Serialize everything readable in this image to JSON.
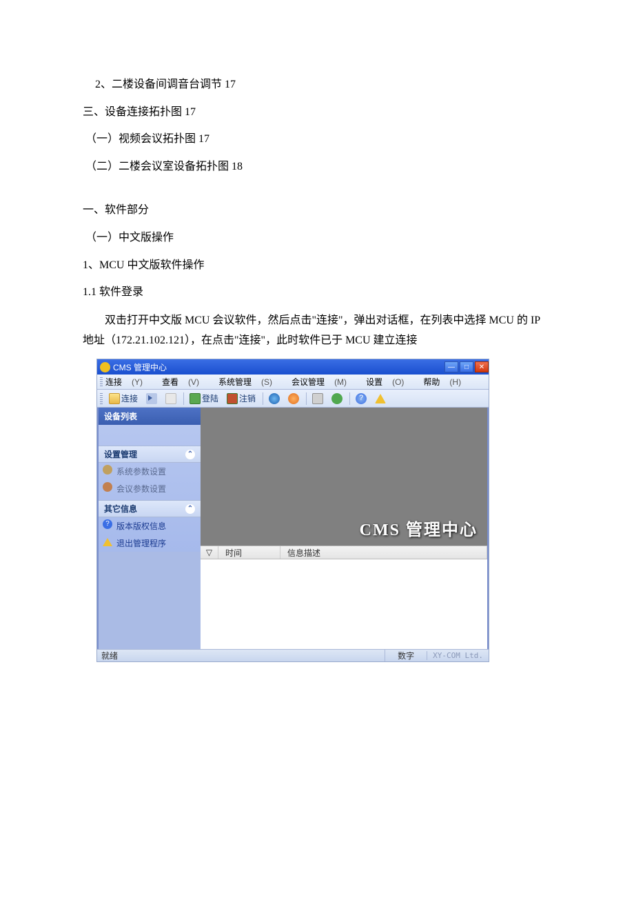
{
  "toc": {
    "line1": "2、二楼设备间调音台调节 17",
    "line2": "三、设备连接拓扑图 17",
    "line3": "（一）视频会议拓扑图 17",
    "line4": "（二）二楼会议室设备拓扑图 18"
  },
  "headings": {
    "h1": "一、软件部分",
    "h1_1": "（一）中文版操作",
    "h1_1_1": "1、MCU 中文版软件操作",
    "h1_1_1_1": "1.1 软件登录"
  },
  "paragraph": "双击打开中文版 MCU 会议软件，然后点击\"连接\"，弹出对话框，在列表中选择 MCU 的 IP 地址（172.21.102.121），在点击\"连接\"，此时软件已于 MCU 建立连接",
  "app": {
    "title": "CMS 管理中心",
    "menu": {
      "connect": "连接",
      "connect_k": "(Y)",
      "view": "查看",
      "view_k": "(V)",
      "sysmgmt": "系统管理",
      "sysmgmt_k": "(S)",
      "confmgmt": "会议管理",
      "confmgmt_k": "(M)",
      "settings": "设置",
      "settings_k": "(O)",
      "help": "帮助",
      "help_k": "(H)"
    },
    "toolbar": {
      "connect": "连接",
      "login": "登陆",
      "logout": "注销"
    },
    "sidebar": {
      "device_list": "设备列表",
      "settings_mgmt": "设置管理",
      "sys_param": "系统参数设置",
      "conf_param": "会议参数设置",
      "other_info": "其它信息",
      "version_info": "版本版权信息",
      "exit": "退出管理程序"
    },
    "canvas": {
      "brand": "CMS 管理中心"
    },
    "log": {
      "sort": "▽",
      "col_time": "时间",
      "col_desc": "信息描述"
    },
    "status": {
      "ready": "就绪",
      "mode": "数字",
      "brand": "XY-COM Ltd."
    }
  }
}
